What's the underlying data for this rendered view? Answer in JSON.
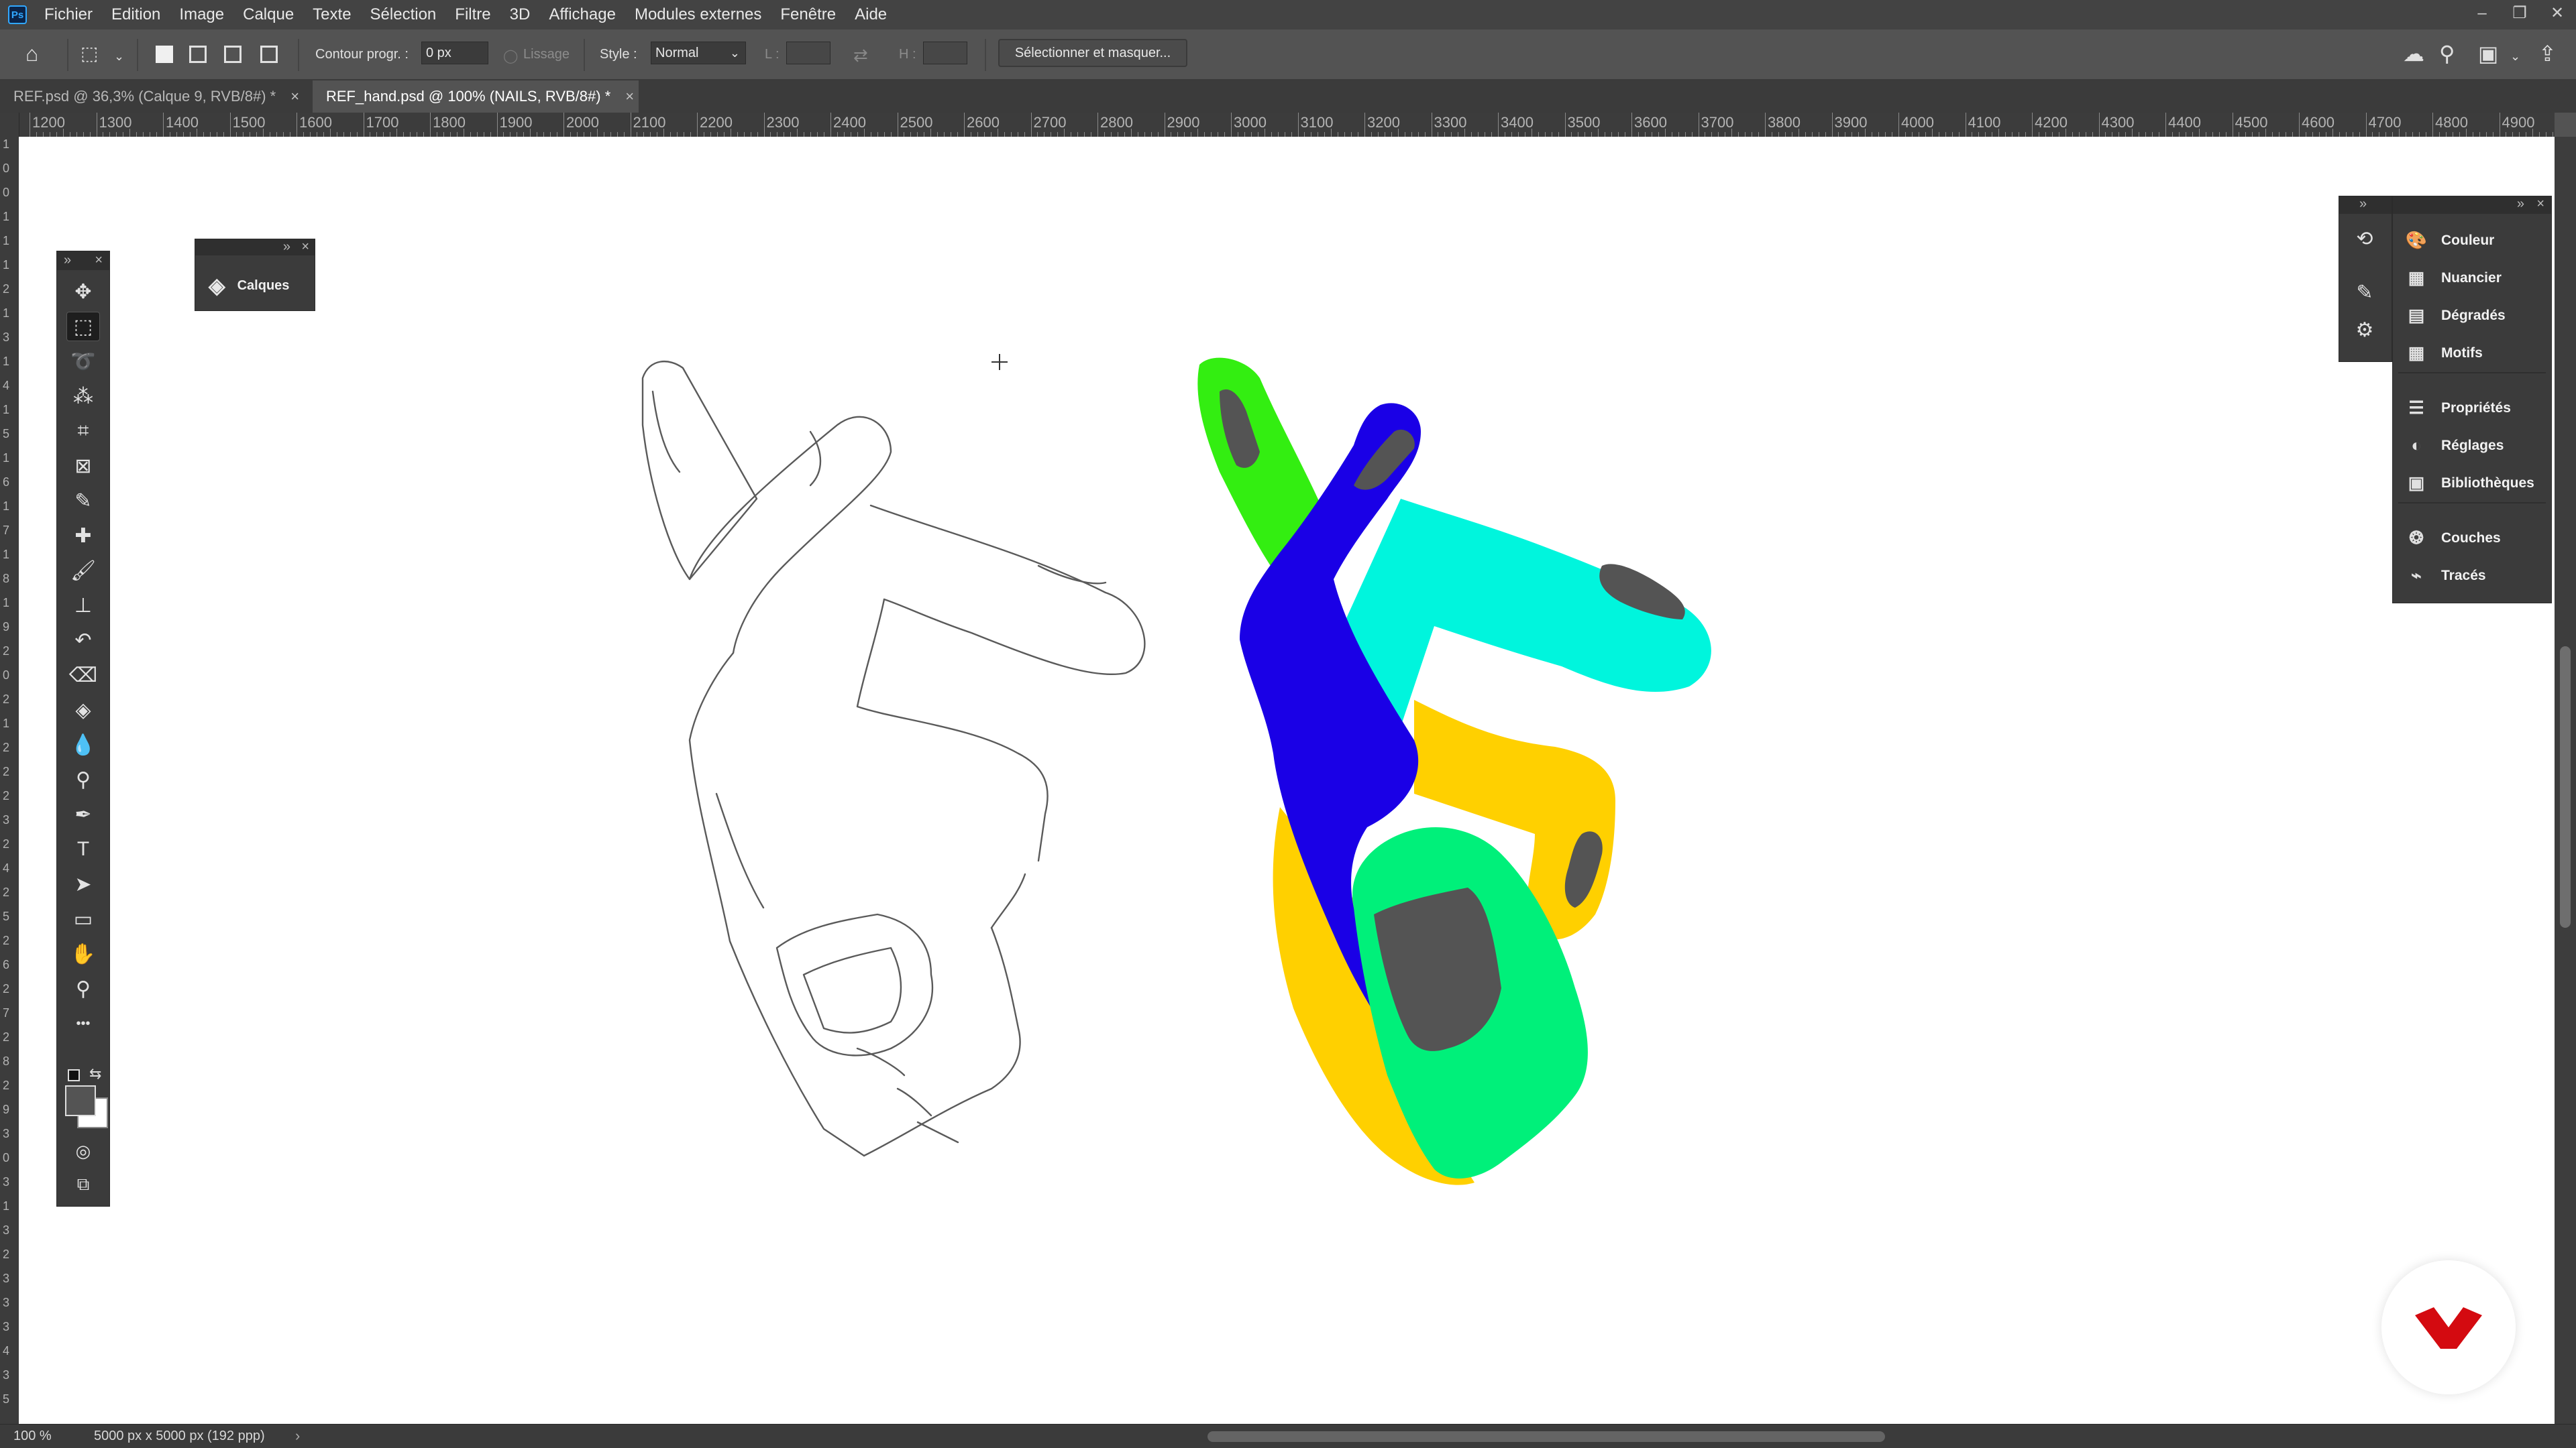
{
  "app": {
    "logo_text": "Ps"
  },
  "menu": [
    "Fichier",
    "Edition",
    "Image",
    "Calque",
    "Texte",
    "Sélection",
    "Filtre",
    "3D",
    "Affichage",
    "Modules externes",
    "Fenêtre",
    "Aide"
  ],
  "window_controls": {
    "minimize": "–",
    "restore": "❐",
    "close": "✕"
  },
  "options": {
    "contour_label": "Contour progr. :",
    "contour_value": "0 px",
    "lissage_label": "Lissage",
    "style_label": "Style :",
    "style_value": "Normal",
    "width_label": "L :",
    "height_label": "H :",
    "select_mask_button": "Sélectionner et masquer..."
  },
  "tabs": [
    {
      "label": "REF.psd @ 36,3% (Calque 9, RVB/8#) *",
      "active": false
    },
    {
      "label": "REF_hand.psd @ 100% (NAILS, RVB/8#) *",
      "active": true
    }
  ],
  "ruler_h": [
    "1200",
    "1300",
    "1400",
    "1500",
    "1600",
    "1700",
    "1800",
    "1900",
    "2000",
    "2100",
    "2200",
    "2300",
    "2400",
    "2500",
    "2600",
    "2700",
    "2800",
    "2900",
    "3000",
    "3100",
    "3200",
    "3300",
    "3400",
    "3500",
    "3600",
    "3700",
    "3800",
    "3900",
    "4000",
    "4100",
    "4200",
    "4300",
    "4400",
    "4500",
    "4600",
    "4700",
    "4800",
    "4900"
  ],
  "ruler_v": [
    "1",
    "0",
    "0",
    "1",
    "1",
    "1",
    "2",
    "1",
    "3",
    "1",
    "4",
    "1",
    "5",
    "1",
    "6",
    "1",
    "7",
    "1",
    "8",
    "1",
    "9",
    "2",
    "0",
    "2",
    "1",
    "2",
    "2",
    "2",
    "3",
    "2",
    "4",
    "2",
    "5",
    "2",
    "6",
    "2",
    "7",
    "2",
    "8",
    "2",
    "9",
    "3",
    "0",
    "3",
    "1",
    "3",
    "2",
    "3",
    "3",
    "3",
    "4",
    "3",
    "5"
  ],
  "tools": [
    {
      "name": "move-tool",
      "glyph": "✥",
      "selected": false
    },
    {
      "name": "marquee-tool",
      "glyph": "⬚",
      "selected": true
    },
    {
      "name": "lasso-tool",
      "glyph": "➰",
      "selected": false
    },
    {
      "name": "magic-wand-tool",
      "glyph": "⁂",
      "selected": false
    },
    {
      "name": "crop-tool",
      "glyph": "⌗",
      "selected": false
    },
    {
      "name": "frame-tool",
      "glyph": "⊠",
      "selected": false
    },
    {
      "name": "eyedropper-tool",
      "glyph": "✎",
      "selected": false
    },
    {
      "name": "healing-brush-tool",
      "glyph": "✚",
      "selected": false
    },
    {
      "name": "brush-tool",
      "glyph": "🖌",
      "selected": false
    },
    {
      "name": "stamp-tool",
      "glyph": "⊥",
      "selected": false
    },
    {
      "name": "history-brush-tool",
      "glyph": "↶",
      "selected": false
    },
    {
      "name": "eraser-tool",
      "glyph": "⌫",
      "selected": false
    },
    {
      "name": "paint-bucket-tool",
      "glyph": "◈",
      "selected": false
    },
    {
      "name": "blur-tool",
      "glyph": "💧",
      "selected": false
    },
    {
      "name": "dodge-tool",
      "glyph": "⚲",
      "selected": false
    },
    {
      "name": "pen-tool",
      "glyph": "✒",
      "selected": false
    },
    {
      "name": "type-tool",
      "glyph": "T",
      "selected": false
    },
    {
      "name": "path-selection-tool",
      "glyph": "➤",
      "selected": false
    },
    {
      "name": "rectangle-tool",
      "glyph": "▭",
      "selected": false
    },
    {
      "name": "hand-tool",
      "glyph": "✋",
      "selected": false
    },
    {
      "name": "zoom-tool",
      "glyph": "⚲",
      "selected": false
    },
    {
      "name": "more-tools",
      "glyph": "•••",
      "selected": false
    }
  ],
  "calques_panel": {
    "label": "Calques"
  },
  "right_panels": [
    "Couleur",
    "Nuancier",
    "Dégradés",
    "Motifs",
    "Propriétés",
    "Réglages",
    "Bibliothèques",
    "Couches",
    "Tracés"
  ],
  "right_icons": [
    "history-icon",
    "brush-settings-icon",
    "adjust-icon"
  ],
  "status": {
    "zoom": "100 %",
    "doc_info": "5000 px x 5000 px (192 ppp)"
  },
  "colors": {
    "green": "#33ee11",
    "blue": "#1a00e6",
    "cyan": "#00f5dd",
    "yellow": "#ffd000",
    "spring_green": "#00f07a",
    "nail_gray": "#545454",
    "brand_red": "#d40a10"
  }
}
